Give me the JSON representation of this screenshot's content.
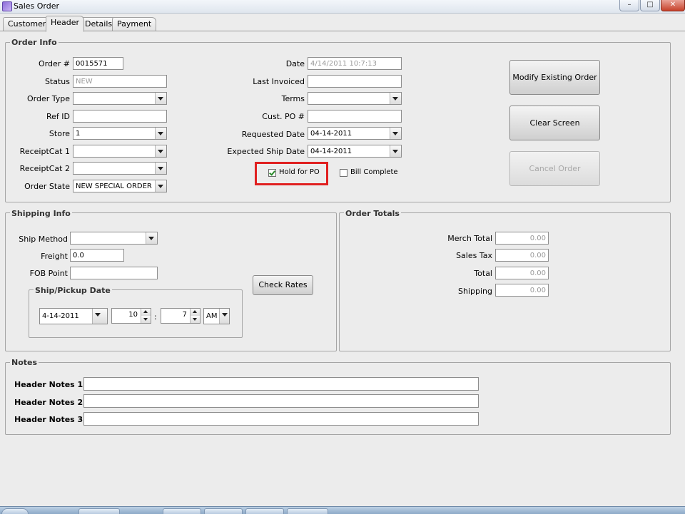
{
  "window": {
    "title": "Sales Order",
    "minimize_glyph": "–",
    "maximize_glyph": "□",
    "close_glyph": "✕"
  },
  "tabs": [
    {
      "label": "Customer",
      "active": false
    },
    {
      "label": "Header",
      "active": true
    },
    {
      "label": "Details",
      "active": false
    },
    {
      "label": "Payment",
      "active": false
    }
  ],
  "order_info": {
    "title": "Order Info",
    "order_no": {
      "label": "Order #",
      "value": "0015571"
    },
    "status": {
      "label": "Status",
      "value": "NEW"
    },
    "order_type": {
      "label": "Order Type",
      "value": ""
    },
    "ref_id": {
      "label": "Ref ID",
      "value": ""
    },
    "store": {
      "label": "Store",
      "value": "1"
    },
    "receipt_cat_1": {
      "label": "ReceiptCat 1",
      "value": ""
    },
    "receipt_cat_2": {
      "label": "ReceiptCat 2",
      "value": ""
    },
    "order_state": {
      "label": "Order State",
      "value": "NEW SPECIAL ORDER"
    },
    "date": {
      "label": "Date",
      "value": "4/14/2011 10:7:13"
    },
    "last_invoiced": {
      "label": "Last Invoiced",
      "value": ""
    },
    "terms": {
      "label": "Terms",
      "value": ""
    },
    "cust_po": {
      "label": "Cust. PO #",
      "value": ""
    },
    "requested_date": {
      "label": "Requested Date",
      "value": "04-14-2011"
    },
    "expected_ship_date": {
      "label": "Expected Ship Date",
      "value": "04-14-2011"
    },
    "hold_for_po": {
      "label": "Hold for PO",
      "checked": true
    },
    "bill_complete": {
      "label": "Bill Complete",
      "checked": false
    },
    "modify_button": "Modify Existing Order",
    "clear_button": "Clear Screen",
    "cancel_button": "Cancel Order"
  },
  "shipping_info": {
    "title": "Shipping Info",
    "ship_method": {
      "label": "Ship Method",
      "value": ""
    },
    "freight": {
      "label": "Freight",
      "value": "0.0"
    },
    "fob_point": {
      "label": "FOB Point",
      "value": ""
    },
    "pickup": {
      "title": "Ship/Pickup Date",
      "date": "4-14-2011",
      "hour": "10",
      "separator": ":",
      "minute": "7",
      "ampm": "AM"
    },
    "check_rates_button": "Check Rates"
  },
  "order_totals": {
    "title": "Order Totals",
    "merch_total": {
      "label": "Merch Total",
      "value": "0.00"
    },
    "sales_tax": {
      "label": "Sales Tax",
      "value": "0.00"
    },
    "total": {
      "label": "Total",
      "value": "0.00"
    },
    "shipping": {
      "label": "Shipping",
      "value": "0.00"
    }
  },
  "notes": {
    "title": "Notes",
    "header_notes_1": {
      "label": "Header Notes 1",
      "value": ""
    },
    "header_notes_2": {
      "label": "Header Notes 2",
      "value": ""
    },
    "header_notes_3": {
      "label": "Header Notes 3",
      "value": ""
    }
  },
  "colors": {
    "highlight": "#e02020",
    "background": "#ececec"
  }
}
